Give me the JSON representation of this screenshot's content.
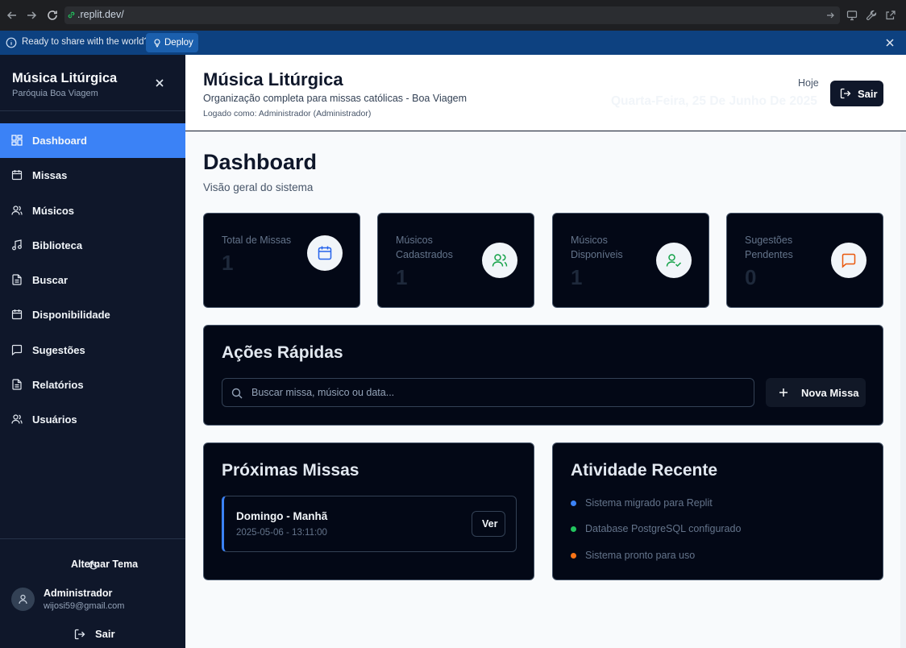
{
  "browser": {
    "url": ".replit.dev/"
  },
  "banner": {
    "text": "Ready to share with the world?",
    "deploy_label": "Deploy"
  },
  "sidebar": {
    "title": "Música Litúrgica",
    "subtitle": "Paróquia Boa Viagem",
    "items": [
      {
        "label": "Dashboard",
        "icon": "dashboard-icon",
        "active": true
      },
      {
        "label": "Missas",
        "icon": "calendar-icon"
      },
      {
        "label": "Músicos",
        "icon": "users-icon"
      },
      {
        "label": "Biblioteca",
        "icon": "music-note-icon"
      },
      {
        "label": "Buscar",
        "icon": "document-icon"
      },
      {
        "label": "Disponibilidade",
        "icon": "calendar-icon"
      },
      {
        "label": "Sugestões",
        "icon": "message-icon"
      },
      {
        "label": "Relatórios",
        "icon": "document-icon"
      },
      {
        "label": "Usuários",
        "icon": "users-icon"
      }
    ],
    "theme_label": "Alternar Tema",
    "user": {
      "name": "Administrador",
      "email": "wijosi59@gmail.com"
    },
    "logout_label": "Sair"
  },
  "header": {
    "title": "Música Litúrgica",
    "subtitle": "Organização completa para missas católicas - Boa Viagem",
    "logged_as": "Logado como: Administrador (Administrador)",
    "today_label": "Hoje",
    "date": "Quarta-Feira, 25 De Junho De 2025",
    "logout_label": "Sair"
  },
  "main": {
    "title": "Dashboard",
    "subtitle": "Visão geral do sistema",
    "stats": [
      {
        "label": "Total de Missas",
        "value": "1",
        "icon": "calendar-icon",
        "color": "#2563eb"
      },
      {
        "label": "Músicos Cadastrados",
        "value": "1",
        "icon": "users-icon",
        "color": "#16a34a"
      },
      {
        "label": "Músicos Disponíveis",
        "value": "1",
        "icon": "user-check-icon",
        "color": "#16a34a"
      },
      {
        "label": "Sugestões Pendentes",
        "value": "0",
        "icon": "message-icon",
        "color": "#ea580c"
      }
    ],
    "quick_actions": {
      "title": "Ações Rápidas",
      "search_placeholder": "Buscar missa, músico ou data...",
      "new_mass_label": "Nova Missa"
    },
    "upcoming": {
      "title": "Próximas Missas",
      "items": [
        {
          "name": "Domingo - Manhã",
          "datetime": "2025-05-06 - 13:11:00",
          "button": "Ver"
        }
      ]
    },
    "activity": {
      "title": "Atividade Recente",
      "items": [
        {
          "text": "Sistema migrado para Replit",
          "color": "#3b82f6"
        },
        {
          "text": "Database PostgreSQL configurado",
          "color": "#22c55e"
        },
        {
          "text": "Sistema pronto para uso",
          "color": "#f97316"
        }
      ]
    }
  }
}
